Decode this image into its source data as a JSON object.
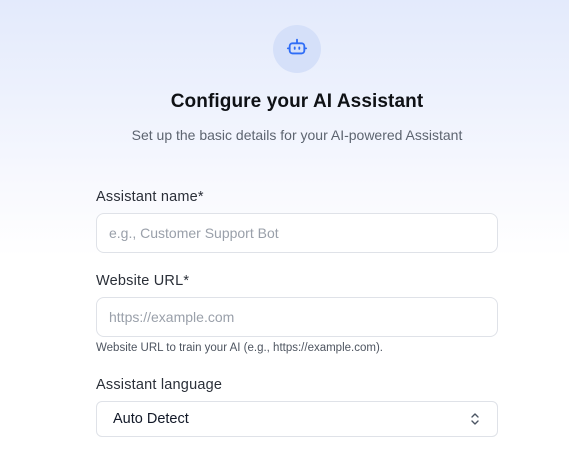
{
  "header": {
    "icon": "bot-icon",
    "title": "Configure your AI Assistant",
    "subtitle": "Set up the basic details for your AI-powered Assistant"
  },
  "form": {
    "assistant_name": {
      "label": "Assistant name*",
      "placeholder": "e.g., Customer Support Bot",
      "value": ""
    },
    "website_url": {
      "label": "Website URL*",
      "placeholder": "https://example.com",
      "value": "",
      "help": "Website URL to train your AI (e.g., https://example.com)."
    },
    "language": {
      "label": "Assistant language",
      "selected": "Auto Detect",
      "icon": "chevron-updown-icon"
    }
  },
  "colors": {
    "accent": "#2f6df6",
    "icon_bg": "#d5e0f9"
  }
}
